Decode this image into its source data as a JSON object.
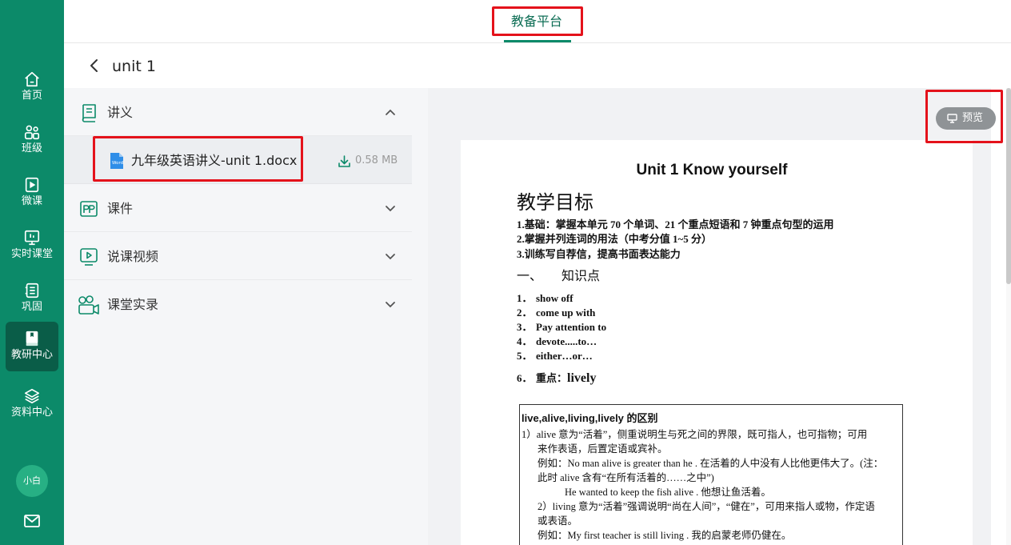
{
  "sidebar": {
    "items": [
      {
        "label": "首页",
        "icon": "home-icon"
      },
      {
        "label": "班级",
        "icon": "users-icon"
      },
      {
        "label": "微课",
        "icon": "video-icon"
      },
      {
        "label": "实时课堂",
        "icon": "live-class-icon"
      },
      {
        "label": "巩固",
        "icon": "notebook-icon"
      },
      {
        "label": "教研中心",
        "icon": "research-book-icon",
        "active": true
      },
      {
        "label": "资料中心",
        "icon": "layers-icon"
      }
    ],
    "avatar": "小白",
    "mail_icon": "mail-icon"
  },
  "header": {
    "tab": "教备平台"
  },
  "breadcrumb": {
    "title": "unit 1"
  },
  "resources": {
    "groups": [
      {
        "title": "讲义",
        "icon": "handout-icon",
        "expanded": true
      },
      {
        "title": "课件",
        "icon": "ppt-icon",
        "expanded": false
      },
      {
        "title": "说课视频",
        "icon": "video-play-icon",
        "expanded": false
      },
      {
        "title": "课堂实录",
        "icon": "camera-record-icon",
        "expanded": false
      }
    ],
    "file": {
      "name": "九年级英语讲义-unit 1.docx",
      "size": "0.58 MB",
      "icon_label": "Word"
    }
  },
  "preview": {
    "button_label": "预览"
  },
  "document": {
    "title": "Unit 1 Know yourself",
    "heading": "教学目标",
    "goals": [
      "1.基础：掌握本单元 70 个单词、21 个重点短语和 7 钟重点句型的运用",
      "2.掌握并列连词的用法（中考分值 1~5 分）",
      "3.训练写自荐信，提高书面表达能力"
    ],
    "section_num": "一、",
    "section_title": "知识点",
    "points": [
      {
        "num": "1．",
        "text": "show off"
      },
      {
        "num": "2．",
        "text": "come up with"
      },
      {
        "num": "3．",
        "text": "Pay attention to"
      },
      {
        "num": "4．",
        "text": "devote.....to…"
      },
      {
        "num": "5．",
        "text": "either…or…"
      }
    ],
    "key_point": {
      "num": "6．",
      "label": "重点：",
      "word": "lively"
    },
    "table": {
      "heading": "live,alive,living,lively 的区别",
      "lines": [
        "1）alive 意为“活着”，侧重说明生与死之间的界限，既可指人，也可指物；可用",
        "来作表语，后置定语或宾补。",
        "例如：No man alive is greater than he . 在活着的人中没有人比他更伟大了。(注：",
        "此时  alive  含有“在所有活着的……之中”)",
        "He wanted to keep the fish alive . 他想让鱼活着。",
        "2）living 意为“活着”强调说明“尚在人间”，“健在”，可用来指人或物，作定语",
        "或表语。",
        "例如：My first teacher is still living . 我的启蒙老师仍健在。"
      ]
    }
  },
  "colors": {
    "sidebar": "#0c8a69",
    "sidebar_active": "#0a5d48",
    "accent_text": "#0c6d54",
    "highlight_box": "#e4121b",
    "panel_bg": "#f5f6f8",
    "preview_bg": "#f1f2f4"
  }
}
